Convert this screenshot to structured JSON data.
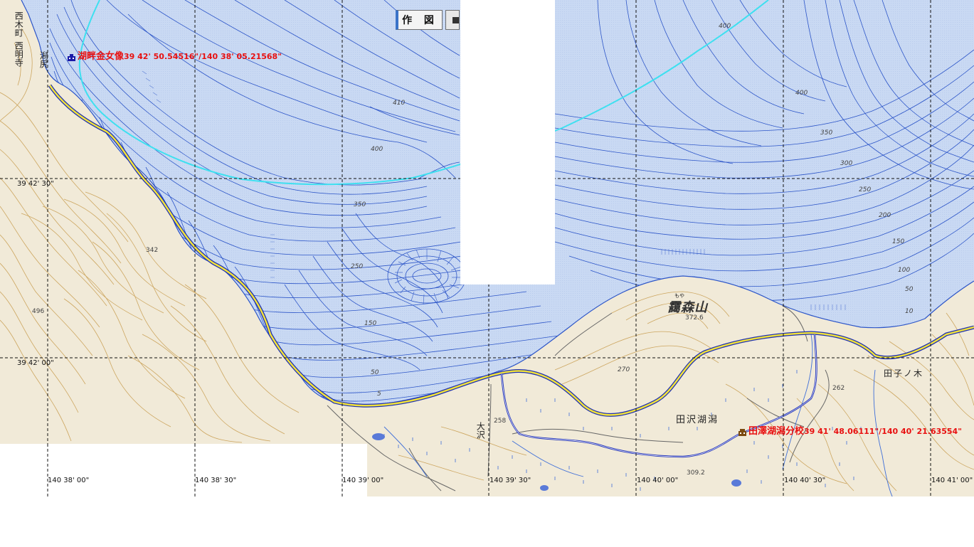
{
  "toolbar": {
    "draw_label": "作 図"
  },
  "grid": {
    "lon_labels": [
      "140 38' 00\"",
      "140 38' 30\"",
      "140 39' 00\"",
      "140 39' 30\"",
      "140 40' 00\"",
      "140 40' 30\"",
      "140 41' 00\""
    ],
    "lat_labels": [
      "39 42' 30\"",
      "39 42' 00\""
    ]
  },
  "places": {
    "nishikimachi": "西木町",
    "nishimyoji": "西明寺",
    "katajiri": "潟尻",
    "osawa": "大沢",
    "tazawakogata": "田沢湖潟",
    "tagonoki": "田子ノ木",
    "mountain_furigana": "もや",
    "mountain": "靄森山"
  },
  "markers": [
    {
      "name": "湖畔金女像",
      "coord": "39 42' 50.54516\"/140 38' 05.21568\"",
      "icon": "statue-icon",
      "color": "#e81010"
    },
    {
      "name": "田澤湖潟分校",
      "coord": "39 41' 48.06111\"/140 40' 21.63554\"",
      "icon": "school-icon",
      "color": "#e81010"
    }
  ],
  "contour_labels": {
    "depth": [
      "410",
      "400",
      "350",
      "250",
      "150",
      "50",
      "5",
      "400",
      "350",
      "300",
      "250",
      "200",
      "150",
      "100",
      "50",
      "10",
      "400"
    ],
    "elevation": [
      "342",
      "496",
      "270",
      "258",
      "262"
    ],
    "summits": [
      "372.6",
      "309.2"
    ]
  },
  "colors": {
    "lake": "#c9d9f3",
    "land": "#f1ead8",
    "contour_land": "#c69a4a",
    "contour_lake": "#2c55c8",
    "road_yellow": "#f2e23a",
    "road_blue": "#1c2fb3",
    "route": "#3ee0f0",
    "marker": "#e81010"
  }
}
